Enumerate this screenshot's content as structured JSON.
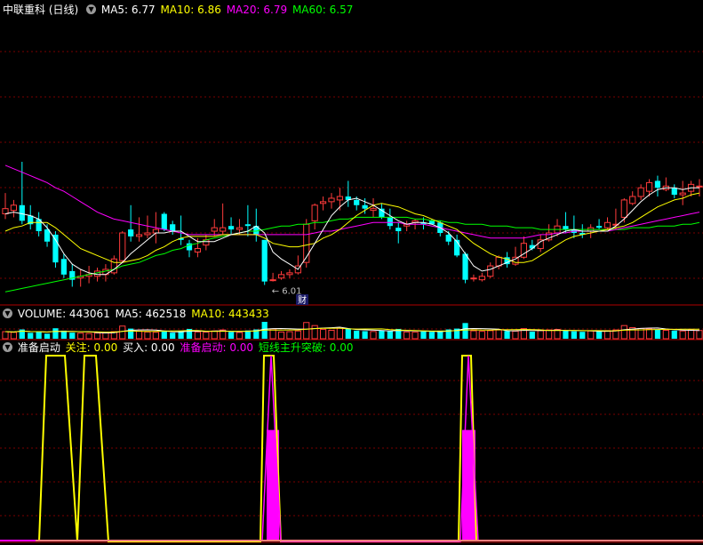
{
  "colors": {
    "up": "#ff3b3b",
    "down": "#00ffff",
    "ma5": "#ffffff",
    "ma10": "#ffff00",
    "ma20": "#ff00ff",
    "ma60": "#00ff00",
    "grid": "#7a0000",
    "label": "#c0c0c0"
  },
  "main_header": {
    "title": "中联重科 (日线)",
    "ma5": "MA5: 6.77",
    "ma10": "MA10: 6.86",
    "ma20": "MA20: 6.79",
    "ma60": "MA60: 6.57"
  },
  "volume_header": {
    "title": "VOLUME: 443061",
    "ma5": "MA5: 462518",
    "ma10": "MA10: 443433"
  },
  "indicator_header": {
    "title": "准备启动",
    "guanzhu": "关注: 0.00",
    "mairu": "买入: 0.00",
    "zhunbei": "准备启动: 0.00",
    "duanxian": "短线主升突破: 0.00"
  },
  "annotations": {
    "low_label": "← 6.01",
    "cai_badge": "财"
  },
  "icons": {
    "dropdown": "chevron-down-icon"
  },
  "chart_data": [
    {
      "type": "candlestick",
      "title": "中联重科 (日线)",
      "ylim": [
        5.9,
        7.55
      ],
      "grid": true,
      "candles": [
        [
          6.42,
          6.45,
          6.39,
          6.54
        ],
        [
          6.44,
          6.47,
          6.4,
          6.5
        ],
        [
          6.47,
          6.38,
          6.36,
          6.72
        ],
        [
          6.41,
          6.36,
          6.33,
          6.47
        ],
        [
          6.39,
          6.32,
          6.29,
          6.43
        ],
        [
          6.33,
          6.26,
          6.23,
          6.36
        ],
        [
          6.3,
          6.14,
          6.11,
          6.32
        ],
        [
          6.16,
          6.07,
          6.05,
          6.19
        ],
        [
          6.09,
          6.04,
          6.0,
          6.13
        ],
        [
          6.05,
          6.06,
          6.0,
          6.1
        ],
        [
          6.06,
          6.07,
          6.02,
          6.12
        ],
        [
          6.06,
          6.09,
          6.03,
          6.11
        ],
        [
          6.07,
          6.1,
          6.03,
          6.13
        ],
        [
          6.08,
          6.16,
          6.07,
          6.18
        ],
        [
          6.15,
          6.31,
          6.14,
          6.32
        ],
        [
          6.33,
          6.29,
          6.26,
          6.47
        ],
        [
          6.29,
          6.3,
          6.26,
          6.4
        ],
        [
          6.3,
          6.31,
          6.28,
          6.41
        ],
        [
          6.31,
          6.33,
          6.25,
          6.43
        ],
        [
          6.42,
          6.33,
          6.32,
          6.43
        ],
        [
          6.36,
          6.32,
          6.3,
          6.38
        ],
        [
          6.28,
          6.27,
          6.24,
          6.41
        ],
        [
          6.25,
          6.21,
          6.17,
          6.27
        ],
        [
          6.2,
          6.22,
          6.17,
          6.28
        ],
        [
          6.24,
          6.27,
          6.21,
          6.3
        ],
        [
          6.32,
          6.34,
          6.29,
          6.39
        ],
        [
          6.32,
          6.34,
          6.3,
          6.48
        ],
        [
          6.35,
          6.33,
          6.3,
          6.4
        ],
        [
          6.33,
          6.34,
          6.3,
          6.39
        ],
        [
          6.36,
          6.35,
          6.29,
          6.47
        ],
        [
          6.35,
          6.3,
          6.26,
          6.45
        ],
        [
          6.27,
          6.03,
          6.01,
          6.27
        ],
        [
          6.04,
          6.04,
          6.03,
          6.08
        ],
        [
          6.05,
          6.07,
          6.04,
          6.09
        ],
        [
          6.07,
          6.08,
          6.05,
          6.1
        ],
        [
          6.08,
          6.12,
          6.07,
          6.18
        ],
        [
          6.14,
          6.36,
          6.11,
          6.39
        ],
        [
          6.38,
          6.47,
          6.33,
          6.48
        ],
        [
          6.48,
          6.49,
          6.44,
          6.52
        ],
        [
          6.49,
          6.51,
          6.45,
          6.54
        ],
        [
          6.5,
          6.52,
          6.44,
          6.57
        ],
        [
          6.52,
          6.5,
          6.46,
          6.61
        ],
        [
          6.5,
          6.47,
          6.44,
          6.52
        ],
        [
          6.47,
          6.45,
          6.42,
          6.51
        ],
        [
          6.44,
          6.45,
          6.4,
          6.51
        ],
        [
          6.45,
          6.4,
          6.39,
          6.48
        ],
        [
          6.4,
          6.35,
          6.33,
          6.45
        ],
        [
          6.34,
          6.32,
          6.25,
          6.37
        ],
        [
          6.35,
          6.36,
          6.32,
          6.38
        ],
        [
          6.37,
          6.38,
          6.33,
          6.39
        ],
        [
          6.37,
          6.36,
          6.33,
          6.4
        ],
        [
          6.38,
          6.36,
          6.36,
          6.39
        ],
        [
          6.37,
          6.31,
          6.29,
          6.38
        ],
        [
          6.3,
          6.26,
          6.24,
          6.32
        ],
        [
          6.27,
          6.18,
          6.17,
          6.3
        ],
        [
          6.19,
          6.04,
          6.02,
          6.2
        ],
        [
          6.05,
          6.05,
          6.03,
          6.07
        ],
        [
          6.04,
          6.06,
          6.03,
          6.08
        ],
        [
          6.06,
          6.12,
          6.05,
          6.14
        ],
        [
          6.12,
          6.17,
          6.1,
          6.18
        ],
        [
          6.17,
          6.13,
          6.11,
          6.2
        ],
        [
          6.13,
          6.17,
          6.12,
          6.23
        ],
        [
          6.17,
          6.25,
          6.16,
          6.29
        ],
        [
          6.24,
          6.22,
          6.21,
          6.27
        ],
        [
          6.22,
          6.27,
          6.2,
          6.3
        ],
        [
          6.27,
          6.31,
          6.26,
          6.36
        ],
        [
          6.31,
          6.35,
          6.29,
          6.39
        ],
        [
          6.35,
          6.33,
          6.31,
          6.43
        ],
        [
          6.33,
          6.31,
          6.28,
          6.41
        ],
        [
          6.31,
          6.3,
          6.28,
          6.36
        ],
        [
          6.32,
          6.34,
          6.28,
          6.36
        ],
        [
          6.35,
          6.34,
          6.33,
          6.39
        ],
        [
          6.34,
          6.37,
          6.33,
          6.4
        ],
        [
          6.36,
          6.36,
          6.33,
          6.45
        ],
        [
          6.4,
          6.5,
          6.37,
          6.51
        ],
        [
          6.48,
          6.52,
          6.47,
          6.55
        ],
        [
          6.52,
          6.57,
          6.5,
          6.59
        ],
        [
          6.55,
          6.6,
          6.52,
          6.62
        ],
        [
          6.61,
          6.57,
          6.52,
          6.64
        ],
        [
          6.56,
          6.58,
          6.55,
          6.63
        ],
        [
          6.57,
          6.53,
          6.51,
          6.59
        ],
        [
          6.53,
          6.54,
          6.47,
          6.61
        ],
        [
          6.55,
          6.59,
          6.52,
          6.61
        ],
        [
          6.58,
          6.58,
          6.52,
          6.62
        ]
      ],
      "ma5": [
        6.42,
        6.43,
        6.42,
        6.41,
        6.39,
        6.34,
        6.27,
        6.19,
        6.13,
        6.1,
        6.08,
        6.07,
        6.07,
        6.1,
        6.14,
        6.19,
        6.23,
        6.27,
        6.31,
        6.31,
        6.32,
        6.32,
        6.29,
        6.26,
        6.26,
        6.26,
        6.28,
        6.3,
        6.31,
        6.32,
        6.35,
        6.31,
        6.2,
        6.16,
        6.13,
        6.1,
        6.17,
        6.25,
        6.33,
        6.41,
        6.46,
        6.5,
        6.51,
        6.49,
        6.47,
        6.44,
        6.41,
        6.38,
        6.36,
        6.37,
        6.37,
        6.36,
        6.34,
        6.31,
        6.26,
        6.19,
        6.12,
        6.09,
        6.1,
        6.12,
        6.14,
        6.16,
        6.19,
        6.22,
        6.26,
        6.28,
        6.3,
        6.32,
        6.33,
        6.32,
        6.32,
        6.32,
        6.32,
        6.35,
        6.39,
        6.44,
        6.49,
        6.53,
        6.56,
        6.57,
        6.57,
        6.56,
        6.57,
        6.57
      ],
      "ma10": [
        6.32,
        6.34,
        6.35,
        6.37,
        6.37,
        6.37,
        6.34,
        6.3,
        6.26,
        6.22,
        6.2,
        6.18,
        6.16,
        6.14,
        6.14,
        6.15,
        6.16,
        6.18,
        6.21,
        6.23,
        6.26,
        6.28,
        6.29,
        6.29,
        6.29,
        6.29,
        6.3,
        6.3,
        6.3,
        6.3,
        6.3,
        6.28,
        6.25,
        6.24,
        6.23,
        6.23,
        6.24,
        6.25,
        6.28,
        6.3,
        6.33,
        6.37,
        6.41,
        6.44,
        6.47,
        6.48,
        6.47,
        6.46,
        6.44,
        6.42,
        6.41,
        6.39,
        6.37,
        6.35,
        6.33,
        6.29,
        6.25,
        6.22,
        6.19,
        6.17,
        6.16,
        6.14,
        6.14,
        6.15,
        6.18,
        6.21,
        6.24,
        6.27,
        6.29,
        6.3,
        6.31,
        6.32,
        6.33,
        6.34,
        6.35,
        6.37,
        6.4,
        6.43,
        6.46,
        6.48,
        6.5,
        6.51,
        6.53,
        6.54
      ],
      "ma20": [
        6.7,
        6.68,
        6.66,
        6.64,
        6.62,
        6.6,
        6.57,
        6.55,
        6.52,
        6.49,
        6.46,
        6.43,
        6.41,
        6.39,
        6.38,
        6.37,
        6.36,
        6.35,
        6.34,
        6.33,
        6.32,
        6.31,
        6.3,
        6.3,
        6.3,
        6.3,
        6.3,
        6.3,
        6.3,
        6.3,
        6.3,
        6.3,
        6.3,
        6.3,
        6.3,
        6.3,
        6.3,
        6.31,
        6.32,
        6.32,
        6.33,
        6.34,
        6.35,
        6.36,
        6.37,
        6.37,
        6.37,
        6.37,
        6.36,
        6.36,
        6.36,
        6.35,
        6.34,
        6.33,
        6.32,
        6.31,
        6.3,
        6.29,
        6.28,
        6.28,
        6.28,
        6.28,
        6.28,
        6.29,
        6.3,
        6.3,
        6.31,
        6.31,
        6.32,
        6.32,
        6.32,
        6.32,
        6.32,
        6.33,
        6.34,
        6.35,
        6.36,
        6.37,
        6.38,
        6.39,
        6.4,
        6.41,
        6.42,
        6.43
      ],
      "ma60": [
        5.97,
        5.98,
        5.99,
        6.0,
        6.01,
        6.02,
        6.03,
        6.04,
        6.05,
        6.06,
        6.07,
        6.08,
        6.09,
        6.1,
        6.12,
        6.13,
        6.14,
        6.16,
        6.18,
        6.19,
        6.21,
        6.22,
        6.24,
        6.25,
        6.27,
        6.28,
        6.29,
        6.3,
        6.31,
        6.32,
        6.32,
        6.33,
        6.34,
        6.35,
        6.35,
        6.36,
        6.36,
        6.37,
        6.37,
        6.38,
        6.39,
        6.39,
        6.4,
        6.4,
        6.4,
        6.4,
        6.4,
        6.4,
        6.4,
        6.39,
        6.39,
        6.38,
        6.38,
        6.37,
        6.37,
        6.36,
        6.36,
        6.36,
        6.35,
        6.35,
        6.35,
        6.34,
        6.34,
        6.34,
        6.33,
        6.33,
        6.33,
        6.33,
        6.33,
        6.33,
        6.33,
        6.33,
        6.33,
        6.33,
        6.33,
        6.34,
        6.34,
        6.34,
        6.35,
        6.35,
        6.35,
        6.36,
        6.36,
        6.37
      ],
      "low_marker": {
        "index": 31,
        "value": 6.01
      }
    },
    {
      "type": "bar",
      "title": "VOLUME",
      "series": [
        {
          "name": "VOLUME",
          "values": [
            0.42,
            0.38,
            0.55,
            0.35,
            0.4,
            0.3,
            0.62,
            0.48,
            0.36,
            0.33,
            0.31,
            0.34,
            0.38,
            0.42,
            0.75,
            0.6,
            0.45,
            0.4,
            0.38,
            0.48,
            0.36,
            0.44,
            0.58,
            0.4,
            0.39,
            0.46,
            0.52,
            0.4,
            0.37,
            0.49,
            0.55,
            1.0,
            0.58,
            0.4,
            0.42,
            0.46,
            0.96,
            0.78,
            0.55,
            0.5,
            0.62,
            0.58,
            0.48,
            0.45,
            0.43,
            0.5,
            0.46,
            0.58,
            0.4,
            0.39,
            0.43,
            0.41,
            0.48,
            0.55,
            0.6,
            0.93,
            0.47,
            0.44,
            0.48,
            0.52,
            0.46,
            0.45,
            0.6,
            0.42,
            0.48,
            0.52,
            0.55,
            0.47,
            0.44,
            0.41,
            0.46,
            0.43,
            0.48,
            0.52,
            0.78,
            0.66,
            0.61,
            0.58,
            0.55,
            0.5,
            0.48,
            0.46,
            0.52,
            0.49
          ]
        }
      ]
    },
    {
      "type": "line",
      "title": "准备启动",
      "ylim": [
        0,
        1
      ],
      "series": [
        {
          "name": "关注",
          "color": "#ffff00",
          "values": [
            0,
            0,
            0,
            0,
            0,
            0,
            0,
            0,
            0,
            0,
            0,
            0,
            0,
            0,
            0,
            0,
            0,
            0,
            0,
            0,
            0,
            0,
            0,
            0,
            0,
            0,
            0,
            0,
            0,
            0,
            0,
            0,
            0,
            0,
            0,
            0,
            0,
            0,
            0,
            0,
            0,
            0,
            0,
            0,
            0,
            0,
            0,
            0,
            0,
            0,
            0,
            0,
            0,
            0,
            0,
            0,
            0,
            0,
            0,
            0,
            0,
            0,
            0,
            0,
            0,
            0,
            0,
            0,
            0,
            0,
            0,
            0,
            0,
            0,
            0,
            0,
            0,
            0,
            0,
            0,
            0,
            0,
            0,
            0
          ]
        },
        {
          "name": "准备启动",
          "color": "#ff00ff",
          "values": [
            0,
            0,
            0,
            0,
            0,
            0,
            0,
            0,
            0,
            0,
            0,
            0,
            0,
            0,
            0,
            0,
            0,
            0,
            0,
            0,
            0,
            0,
            0,
            0,
            0,
            0,
            0,
            0,
            0,
            0,
            0,
            0,
            0,
            0,
            0,
            0,
            0,
            0,
            0,
            0,
            0,
            0,
            0,
            0,
            0,
            0,
            0,
            0,
            0,
            0,
            0,
            0,
            0,
            0,
            0,
            0,
            0,
            0,
            0,
            0,
            0,
            0,
            0,
            0,
            0,
            0,
            0,
            0,
            0,
            0,
            0,
            0,
            0,
            0,
            0,
            0,
            0,
            0,
            0,
            0,
            0,
            0,
            0,
            0
          ]
        }
      ],
      "trace_yellow": [
        [
          44,
          0
        ],
        [
          52,
          1
        ],
        [
          73,
          1
        ],
        [
          87,
          0
        ],
        [
          95,
          1
        ],
        [
          108,
          1
        ],
        [
          122,
          0
        ],
        [
          293,
          0
        ],
        [
          297,
          1
        ],
        [
          308,
          1
        ],
        [
          316,
          0
        ],
        [
          516,
          0
        ],
        [
          520,
          1
        ],
        [
          530,
          1
        ],
        [
          536,
          0
        ]
      ],
      "trace_magenta": [
        [
          295,
          0
        ],
        [
          305,
          1
        ],
        [
          316,
          0
        ],
        [
          518,
          0
        ],
        [
          527,
          1
        ],
        [
          538,
          0
        ]
      ],
      "bars_magenta": [
        [
          300,
          314,
          0.6
        ],
        [
          520,
          535,
          0.6
        ]
      ]
    }
  ]
}
